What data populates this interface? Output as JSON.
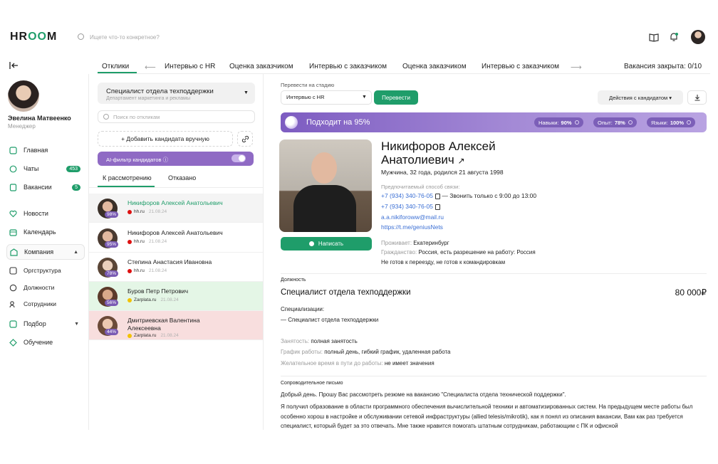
{
  "header": {
    "logo_left": "HR",
    "logo_oo": "OO",
    "logo_right": "M",
    "search_placeholder": "Ищете что-то конкретное?"
  },
  "profile": {
    "name": "Эвелина Матвеенко",
    "role": "Менеджер"
  },
  "sidebar": {
    "items": [
      {
        "label": "Главная",
        "icon": "home-icon"
      },
      {
        "label": "Чаты",
        "icon": "chat-icon",
        "badge": "453"
      },
      {
        "label": "Вакансии",
        "icon": "vacancy-icon",
        "badge": "5"
      },
      {
        "label": "Новости",
        "icon": "heart-icon"
      },
      {
        "label": "Календарь",
        "icon": "calendar-icon"
      },
      {
        "label": "Компания",
        "icon": "company-icon",
        "chevron": "▲"
      },
      {
        "label": "Оргструктура",
        "icon": "org-icon"
      },
      {
        "label": "Должности",
        "icon": "position-icon"
      },
      {
        "label": "Сотрудники",
        "icon": "employees-icon"
      },
      {
        "label": "Подбор",
        "icon": "recruit-icon",
        "chevron": "▼"
      },
      {
        "label": "Обучение",
        "icon": "education-icon"
      }
    ]
  },
  "stage_tabs": {
    "items": [
      "Отклики",
      "Интервью с HR",
      "Оценка заказчиком",
      "Интервью с заказчиком",
      "Оценка заказчиком",
      "Интервью с заказчиком"
    ],
    "left_arrow": "⟵",
    "right_arrow": "⟶",
    "closed_label": "Вакансия закрыта: 0/10"
  },
  "vacancy": {
    "title": "Специалист отдела техподдержки",
    "department": "Департамент маркетинга и рекламы"
  },
  "candidate_search_placeholder": "Поиск по откликам",
  "add_candidate_label": "+ Добавить кандидата вручную",
  "ai_filter_label": "AI-фильтр кандидатов ⓘ",
  "subtabs": {
    "review": "К рассмотрению",
    "rejected": "Отказано"
  },
  "candidates": [
    {
      "name": "Никифоров Алексей Анатольевич",
      "pct": "98%",
      "source": "hh.ru",
      "date": "21.08.24",
      "bg": "#f4f4f4",
      "color": "#1f9d6a"
    },
    {
      "name": "Никифоров Алексей Анатольевич",
      "pct": "95%",
      "source": "hh.ru",
      "date": "21.08.24",
      "bg": "#ffffff",
      "color": "#1f1f1f"
    },
    {
      "name": "Степина Анастасия Ивановна",
      "pct": "78%",
      "source": "hh.ru",
      "date": "21.08.24",
      "bg": "#ffffff",
      "color": "#1f1f1f"
    },
    {
      "name": "Буров Петр Петрович",
      "pct": "56%",
      "source": "Zarplata.ru",
      "date": "21.08.24",
      "bg": "#e4f6e6",
      "color": "#1f1f1f"
    },
    {
      "name": "Дмитриевская Валентина Алексеевна",
      "pct": "44%",
      "source": "Zarplata.ru",
      "date": "21.08.24",
      "bg": "#f8dede",
      "color": "#1f1f1f"
    }
  ],
  "detail": {
    "stage_label": "Перевести на стадию",
    "stage_value": "Интервью с HR",
    "move_button": "Перевести",
    "actions_button": "Действия с кандидатом ▾",
    "match_text": "Подходит на 95%",
    "pills": [
      {
        "label": "Навыки:",
        "value": "90%"
      },
      {
        "label": "Опыт:",
        "value": "78%"
      },
      {
        "label": "Языки:",
        "value": "100%"
      }
    ],
    "write_button": "Написать",
    "name_line1": "Никифоров Алексей",
    "name_line2": "Анатолиевич",
    "demographics": "Мужчина, 32 года, родился 21 августа 1998",
    "contact_label": "Предпочитаемый способ связи:",
    "phone1": "+7 (934) 340-76-05",
    "phone1_note": "— Звонить только с 9:00 до 13:00",
    "phone2": "+7 (934) 340-76-05",
    "email": "a.a.nikiforoww@mail.ru",
    "telegram": "https://t.me/geniusNets",
    "lives_label": "Проживает:",
    "lives_value": "Екатеринбург",
    "citizenship_label": "Гражданство:",
    "citizenship_value": "Россия, есть разрешение на работу: Россия",
    "relocation": "Не готов к переезду, не готов к командировкам",
    "position_section": "Должность",
    "position_title": "Специалист отдела техподдержки",
    "salary": "80 000₽",
    "spec_label": "Специализации:",
    "spec_value": "— Специалист отдела техподдержки",
    "employment_label": "Занятость:",
    "employment_value": "полная занятость",
    "schedule_label": "График работы:",
    "schedule_value": "полный день, гибкий график, удаленная работа",
    "commute_label": "Желательное время в пути до работы:",
    "commute_value": "не имеет значения",
    "letter_section": "Сопроводительное письмо",
    "letter_p1": "Добрый день. Прошу Вас рассмотреть резюме на вакансию \"Специалиста отдела технической поддержки\".",
    "letter_p2": "Я получил образование в области программного обеспечения вычислительной техники и автоматизированных систем. На предыдущем месте работы был особенно хорош в настройке и обслуживании сетевой инфраструктуры (allied telesis/mikrotik), как я понял из описания вакансии, Вам как раз требуется специалист, который будет за это отвечать. Мне также нравится помогать штатным сотрудникам, работающим с ПК и офисной"
  }
}
